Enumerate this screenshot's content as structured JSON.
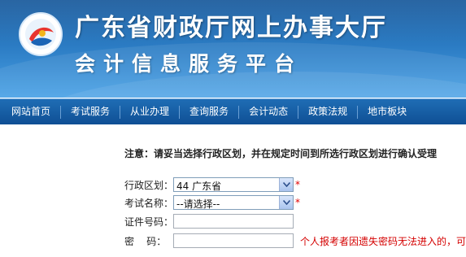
{
  "header": {
    "title": "广东省财政厅网上办事大厅",
    "subtitle": "会计信息服务平台",
    "logo_text": "广东省财政厅"
  },
  "nav": {
    "items": [
      "网站首页",
      "考试服务",
      "从业办理",
      "查询服务",
      "会计动态",
      "政策法规",
      "地市板块"
    ]
  },
  "notice": "注意：请妥当选择行政区划，并在规定时间到所选行政区划进行确认受理",
  "form": {
    "region": {
      "label": "行政区划：",
      "value": "44 广东省"
    },
    "exam": {
      "label": "考试名称：",
      "value": "--请选择--"
    },
    "id_number": {
      "label": "证件号码：",
      "value": ""
    },
    "password": {
      "label": "密    码：",
      "value": "",
      "warning": "个人报考者因遗失密码无法进入的，可"
    },
    "required_mark": "*"
  },
  "colors": {
    "banner": "#2a7ac2",
    "nav": "#1560aa",
    "required": "#e00000",
    "warning": "#d40000"
  }
}
